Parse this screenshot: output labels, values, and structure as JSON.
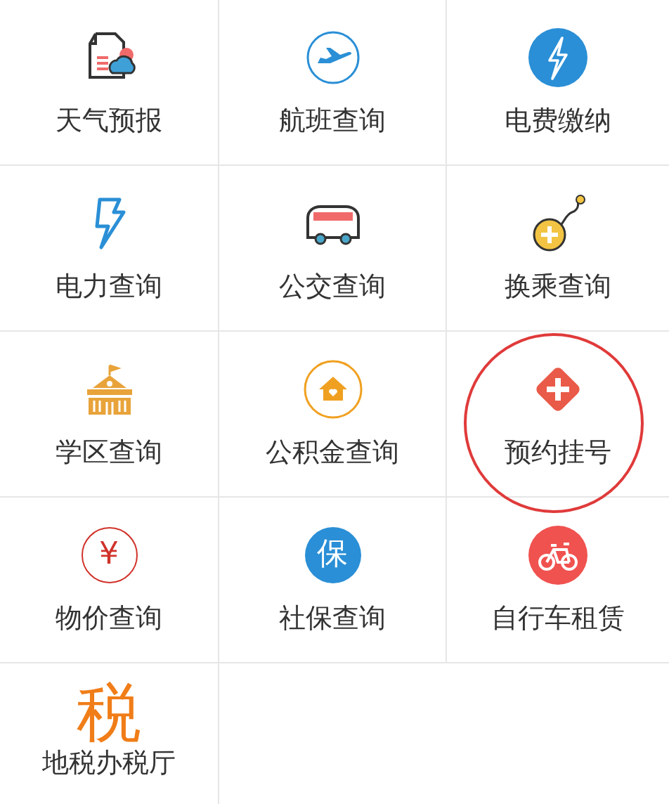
{
  "services": [
    {
      "kind": "weather",
      "label": "天气预报",
      "highlighted": false
    },
    {
      "kind": "plane",
      "label": "航班查询",
      "highlighted": false
    },
    {
      "kind": "bolt-disc",
      "label": "电费缴纳",
      "highlighted": false
    },
    {
      "kind": "bolt",
      "label": "电力查询",
      "highlighted": false
    },
    {
      "kind": "bus",
      "label": "公交查询",
      "highlighted": false
    },
    {
      "kind": "transfer",
      "label": "换乘查询",
      "highlighted": false
    },
    {
      "kind": "school",
      "label": "学区查询",
      "highlighted": false
    },
    {
      "kind": "house-ring",
      "label": "公积金查询",
      "highlighted": false
    },
    {
      "kind": "cross",
      "label": "预约挂号",
      "highlighted": true
    },
    {
      "kind": "glyph-ring",
      "glyph": "¥",
      "label": "物价查询",
      "highlighted": false
    },
    {
      "kind": "glyph-disc",
      "glyph": "保",
      "label": "社保查询",
      "highlighted": false
    },
    {
      "kind": "bike",
      "label": "自行车租赁",
      "highlighted": false
    },
    {
      "kind": "glyph-big",
      "glyph": "税",
      "label": "地税办税厅",
      "highlighted": false
    }
  ]
}
